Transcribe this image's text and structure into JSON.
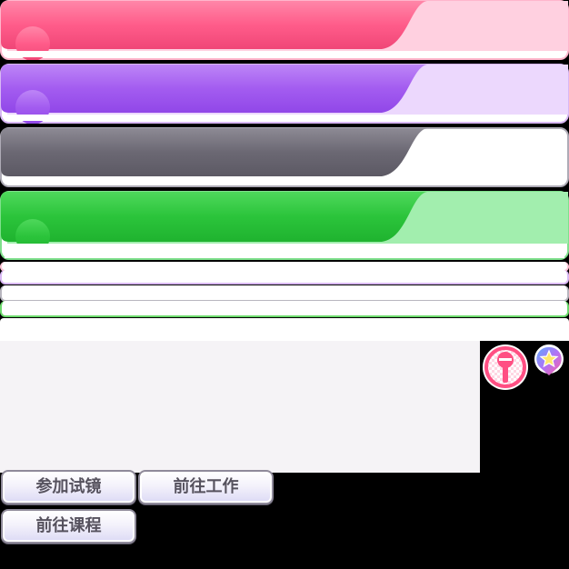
{
  "colors": {
    "pink_tab": "#ff5c8a",
    "pink_tab_light": "#ffd0e0",
    "purple_tab": "#a35cf0",
    "purple_tab_light": "#ecd8fd",
    "gray_tab": "#6b6873",
    "gray_tab_light": "#ffffff",
    "green_tab": "#2bc43b",
    "green_tab_light": "#a2eeae",
    "panel_bg": "#f5f3f6",
    "button_text": "#56525e"
  },
  "icons": {
    "microphone": "microphone-icon",
    "star_badge": "star-badge-icon"
  },
  "actions": {
    "audition_label": "参加试镜",
    "work_label": "前往工作",
    "lesson_label": "前往课程"
  }
}
